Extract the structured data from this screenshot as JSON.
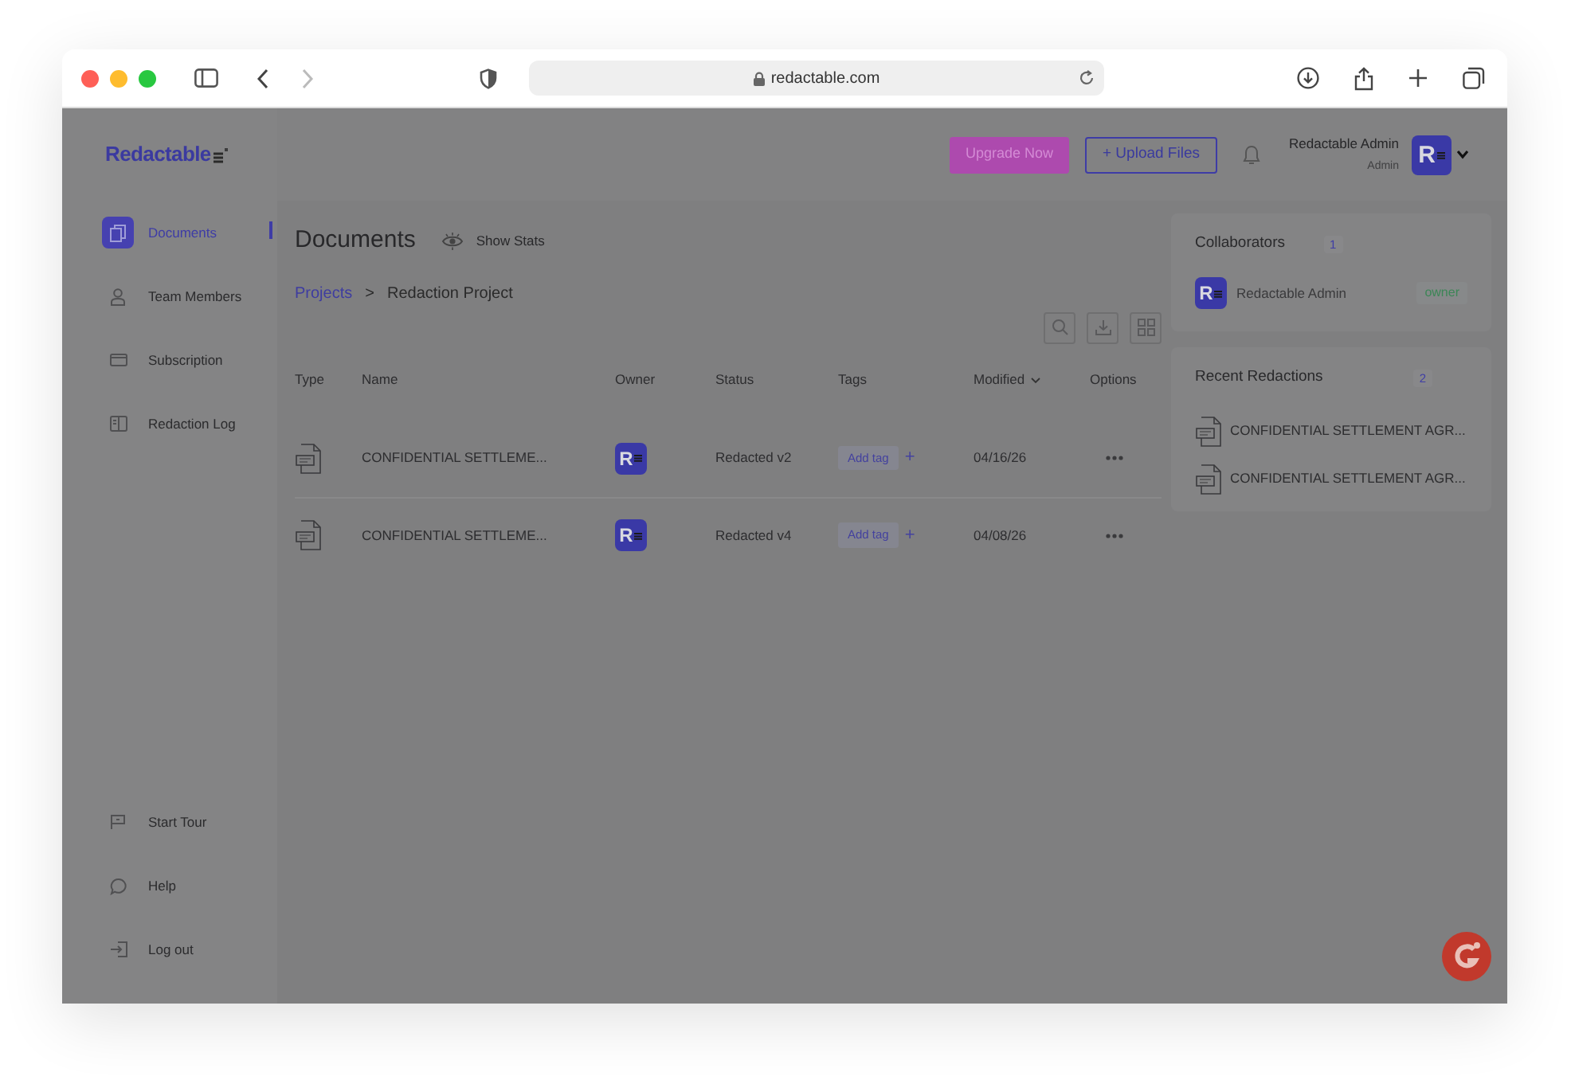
{
  "browser": {
    "url": "redactable.com"
  },
  "header": {
    "logo": "Redactable",
    "upgrade_button": "Upgrade Now",
    "upload_button": "+ Upload Files",
    "user_name": "Redactable Admin",
    "user_role": "Admin",
    "avatar": "R"
  },
  "sidebar": {
    "items": [
      {
        "label": "Documents",
        "kind": "documents",
        "selected": true
      },
      {
        "label": "Team Members",
        "kind": "person",
        "selected": false
      },
      {
        "label": "Subscription",
        "kind": "card",
        "selected": false
      },
      {
        "label": "Redaction Log",
        "kind": "book",
        "selected": false
      }
    ],
    "bottom_items": [
      {
        "label": "Start Tour",
        "kind": "flag"
      },
      {
        "label": "Help",
        "kind": "chat"
      },
      {
        "label": "Log out",
        "kind": "logout"
      }
    ]
  },
  "main": {
    "title": "Documents",
    "show_stats": "Show Stats",
    "breadcrumb": {
      "parent": "Projects",
      "separator": ">",
      "current": "Redaction Project"
    },
    "table": {
      "columns": [
        "Type",
        "Name",
        "Owner",
        "Status",
        "Tags",
        "Modified",
        "Options"
      ],
      "rows": [
        {
          "name": "CONFIDENTIAL SETTLEME...",
          "owner": "R",
          "status": "Redacted v2",
          "tag_button": "Add tag",
          "tag_plus": "+",
          "modified": "04/16/26"
        },
        {
          "name": "CONFIDENTIAL SETTLEME...",
          "owner": "R",
          "status": "Redacted v4",
          "tag_button": "Add tag",
          "tag_plus": "+",
          "modified": "04/08/26"
        }
      ]
    }
  },
  "collaborators": {
    "title": "Collaborators",
    "count": "1",
    "items": [
      {
        "avatar": "R",
        "name": "Redactable Admin",
        "role": "owner"
      }
    ]
  },
  "recent_redactions": {
    "title": "Recent Redactions",
    "count": "2",
    "items": [
      "CONFIDENTIAL SETTLEMENT AGR...",
      "CONFIDENTIAL SETTLEMENT AGR..."
    ]
  }
}
